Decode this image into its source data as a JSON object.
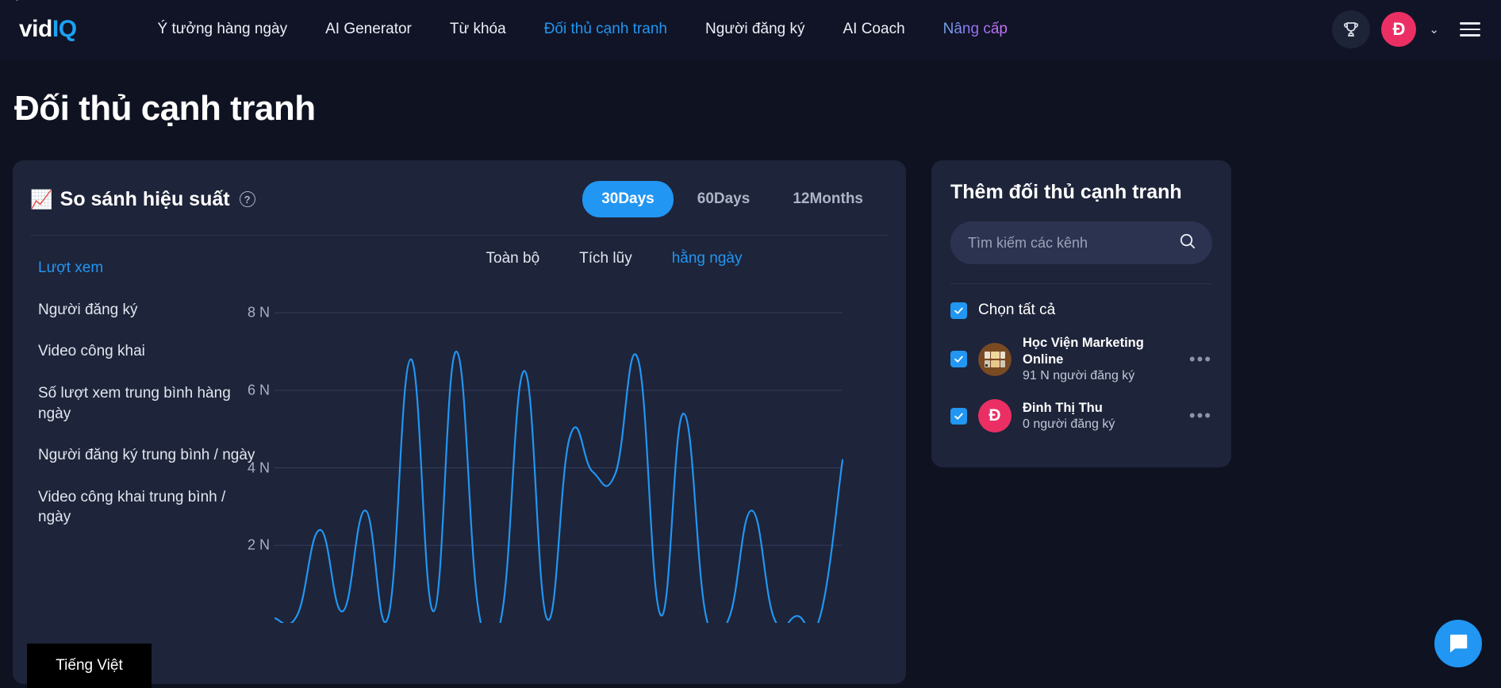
{
  "nav": {
    "logo": {
      "part1": "vid",
      "part2": "IQ"
    },
    "links": [
      {
        "label": "Ý tưởng hàng ngày",
        "state": "default"
      },
      {
        "label": "AI Generator",
        "state": "default"
      },
      {
        "label": "Từ khóa",
        "state": "default"
      },
      {
        "label": "Đối thủ cạnh tranh",
        "state": "active"
      },
      {
        "label": "Người đăng ký",
        "state": "default"
      },
      {
        "label": "AI Coach",
        "state": "default"
      },
      {
        "label": "Nâng cấp",
        "state": "upgrade"
      }
    ],
    "avatar_initial": "Đ",
    "chevron": "⌄"
  },
  "page": {
    "title": "Đối thủ cạnh tranh"
  },
  "chart_card": {
    "emoji": "📈",
    "title": "So sánh hiệu suất",
    "help": "?",
    "ranges": [
      {
        "label": "30Days",
        "active": true
      },
      {
        "label": "60Days",
        "active": false
      },
      {
        "label": "12Months",
        "active": false
      }
    ],
    "metrics": [
      {
        "label": "Lượt xem",
        "active": true
      },
      {
        "label": "Người đăng ký",
        "active": false
      },
      {
        "label": "Video công khai",
        "active": false
      },
      {
        "label": "Số lượt xem trung bình hàng ngày",
        "active": false
      },
      {
        "label": "Người đăng ký trung bình / ngày",
        "active": false
      },
      {
        "label": "Video công khai trung bình / ngày",
        "active": false
      }
    ],
    "plot_tabs": [
      {
        "label": "Toàn bộ",
        "active": false
      },
      {
        "label": "Tích lũy",
        "active": false
      },
      {
        "label": "hằng ngày",
        "active": true
      }
    ]
  },
  "chart_data": {
    "type": "line",
    "title": "So sánh hiệu suất — Lượt xem (hằng ngày)",
    "xlabel": "",
    "ylabel": "",
    "ylim": [
      0,
      8800
    ],
    "ytick_labels": [
      "8 N",
      "6 N",
      "4 N",
      "2 N"
    ],
    "ytick_values": [
      8000,
      6000,
      4000,
      2000
    ],
    "grid": true,
    "legend_position": "none",
    "line_color": "#2196f3",
    "series": [
      {
        "name": "Lượt xem hằng ngày",
        "values": [
          120,
          200,
          2400,
          300,
          2900,
          150,
          6800,
          300,
          7000,
          250,
          200,
          6500,
          100,
          4800,
          3900,
          3850,
          6800,
          200,
          5400,
          150,
          120,
          2900,
          100,
          180,
          140,
          4200
        ]
      }
    ]
  },
  "side_card": {
    "title": "Thêm đối thủ cạnh tranh",
    "search_placeholder": "Tìm kiếm các kênh",
    "search_value": "",
    "select_all_label": "Chọn tất cả",
    "competitors": [
      {
        "name": "Học Viện Marketing Online",
        "subs": "91 N người đăng ký",
        "avatar_type": "image",
        "checked": true,
        "menu": "•••"
      },
      {
        "name": "Đinh Thị Thu",
        "subs": "0 người đăng ký",
        "avatar_type": "initial",
        "avatar_initial": "Đ",
        "checked": true,
        "menu": "•••"
      }
    ]
  },
  "floating": {
    "language": "Tiếng Việt"
  }
}
